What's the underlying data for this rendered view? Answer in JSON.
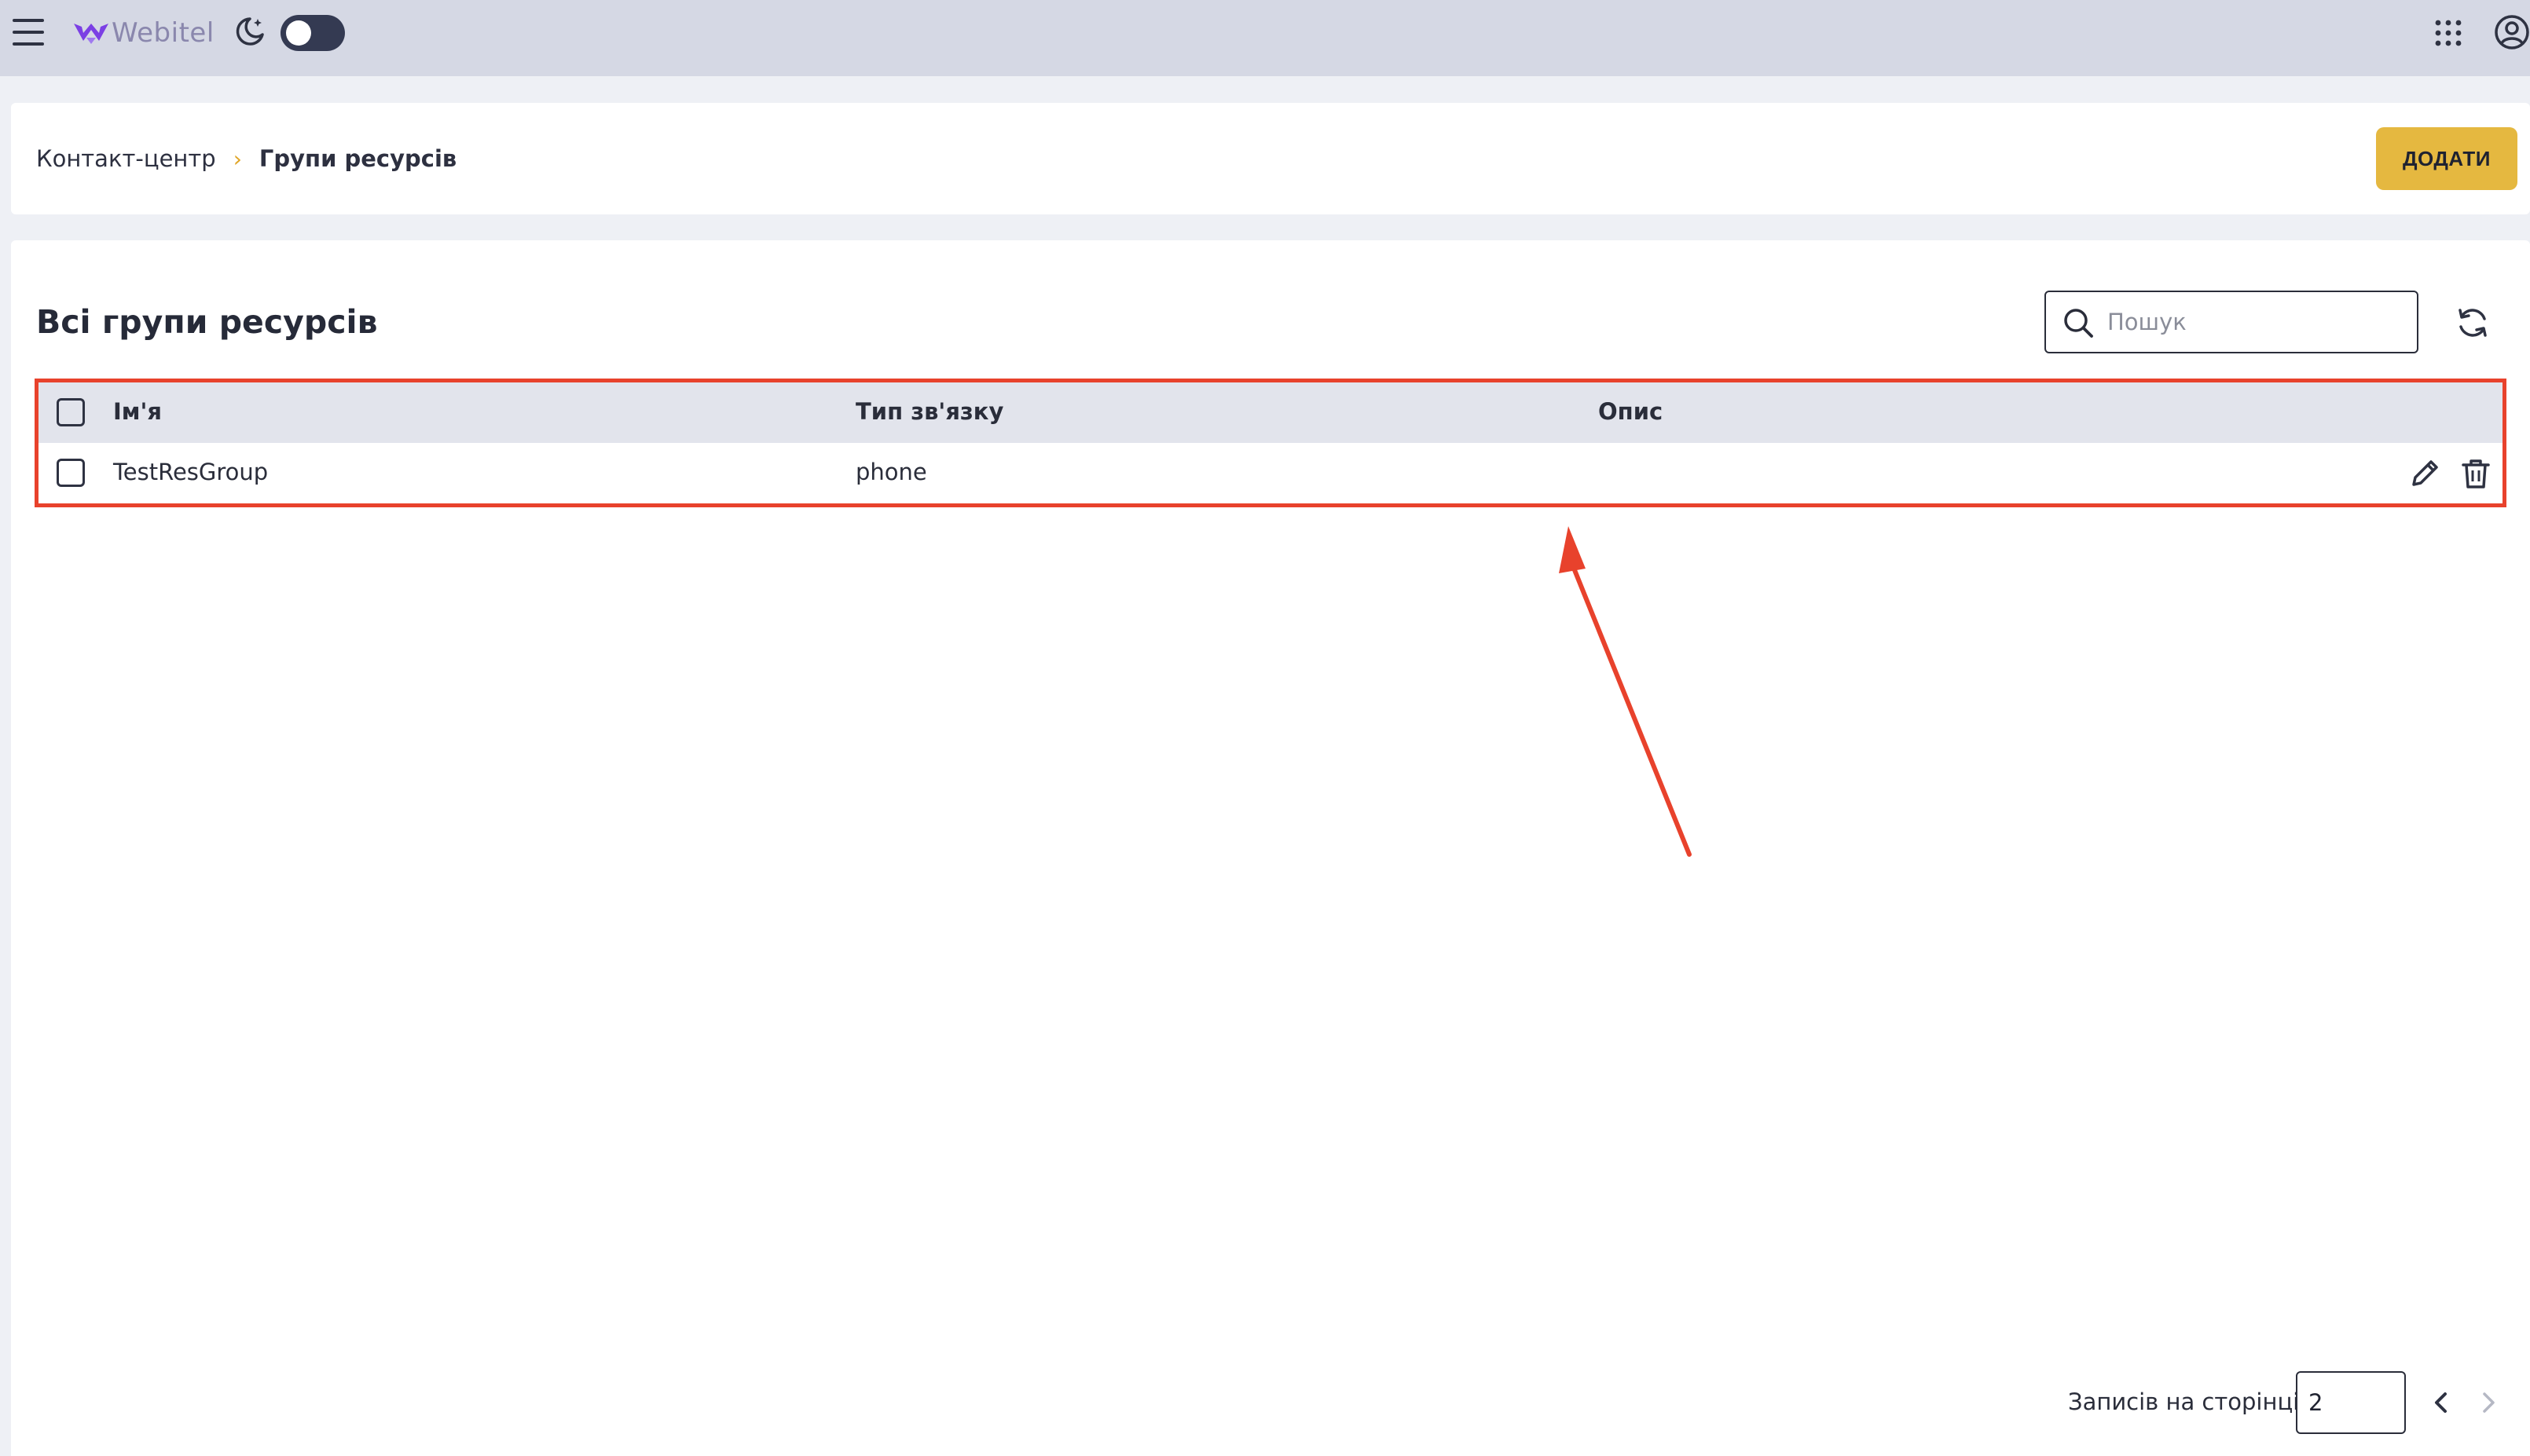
{
  "topbar": {
    "logo_text": "Webitel",
    "theme_toggle_on": false,
    "icons": [
      "menu-icon",
      "webitel-logo-icon",
      "moon-icon",
      "apps-grid-icon",
      "account-icon"
    ]
  },
  "breadcrumb": {
    "root": "Контакт-центр",
    "separator": "›",
    "current": "Групи ресурсів"
  },
  "header": {
    "add_label": "ДОДАТИ"
  },
  "main": {
    "title": "Всі групи ресурсів",
    "search": {
      "placeholder": "Пошук",
      "value": ""
    }
  },
  "table": {
    "columns": [
      "Ім'я",
      "Тип зв'язку",
      "Опис"
    ],
    "rows": [
      {
        "name": "TestResGroup",
        "type": "phone",
        "description": ""
      }
    ]
  },
  "pagination": {
    "label": "Записів на сторінці:",
    "per_page": "2"
  },
  "colors": {
    "accent": "#e5b840",
    "highlight": "#e8422c",
    "topbar": "#d5d8e4",
    "table_header": "#e2e4ec"
  }
}
